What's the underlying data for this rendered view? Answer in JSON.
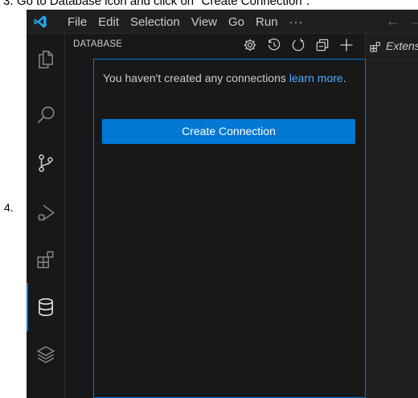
{
  "doc": {
    "line_number": "3.",
    "instruction": "Go to Database icon and click on \"Create Connection\".",
    "step_number": "4."
  },
  "titlebar": {
    "menu": [
      "File",
      "Edit",
      "Selection",
      "View",
      "Go",
      "Run"
    ],
    "more": "···",
    "back_glyph": "←",
    "forward_glyph": "→"
  },
  "activity_bar": {
    "icons": [
      "explorer-icon",
      "search-icon",
      "source-control-icon",
      "run-debug-icon",
      "extensions-icon",
      "database-icon",
      "layers-icon"
    ],
    "active": "database-icon",
    "accent_color": "#0078d4"
  },
  "sidebar": {
    "title": "DATABASE",
    "actions": [
      "settings-icon",
      "history-icon",
      "refresh-icon",
      "collapse-all-icon",
      "add-icon"
    ],
    "welcome_text": "You haven't created any connections ",
    "learn_more_link": "learn more",
    "welcome_suffix": ".",
    "create_button": "Create Connection"
  },
  "editor": {
    "tab_label": "Extensions"
  },
  "colors": {
    "window_bg": "#1f1f1f",
    "sidebar_bg": "#181818",
    "accent": "#0078d4",
    "link": "#4daafc",
    "text": "#cccccc"
  }
}
